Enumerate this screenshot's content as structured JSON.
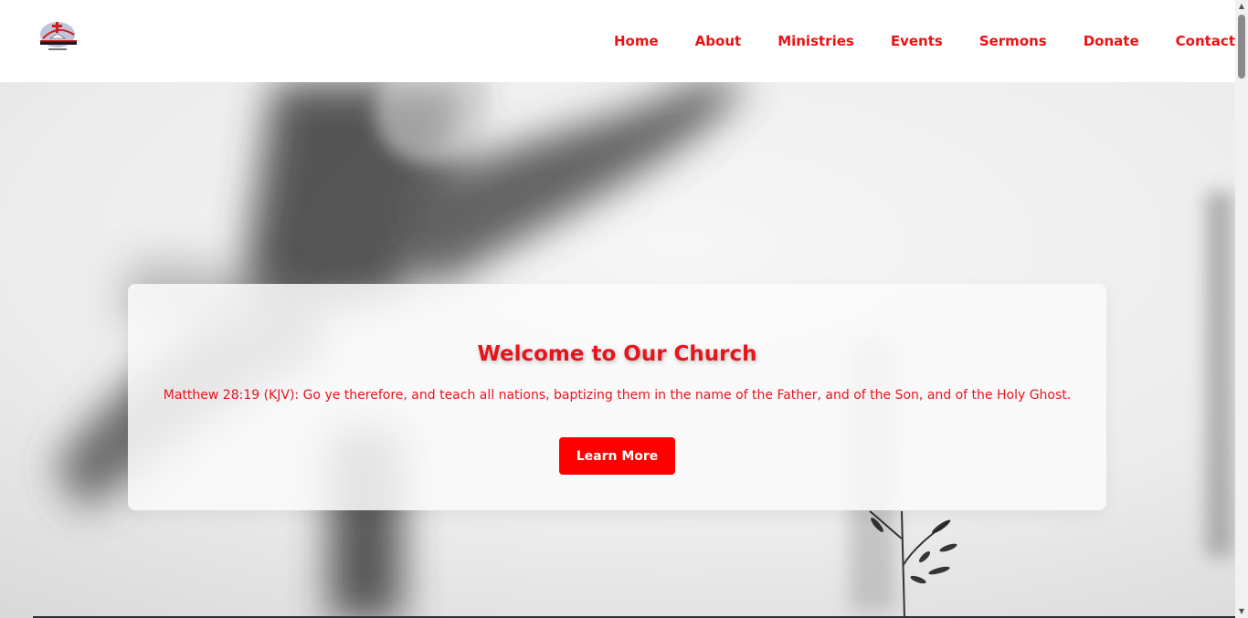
{
  "header": {
    "logo_alt": "Church of Christ logo",
    "nav": [
      {
        "label": "Home"
      },
      {
        "label": "About"
      },
      {
        "label": "Ministries"
      },
      {
        "label": "Events"
      },
      {
        "label": "Sermons"
      },
      {
        "label": "Donate"
      },
      {
        "label": "Contact"
      }
    ]
  },
  "hero": {
    "title": "Welcome to Our Church",
    "verse": "Matthew 28:19 (KJV): Go ye therefore, and teach all nations, baptizing them in the name of the Father, and of the Son, and of the Holy Ghost.",
    "button_label": "Learn More"
  },
  "colors": {
    "accent": "#ee1111",
    "button": "#ff0000"
  },
  "icons": {
    "logo": "church-logo-icon",
    "scroll_up": "chevron-up-icon",
    "scroll_down": "chevron-down-icon"
  }
}
